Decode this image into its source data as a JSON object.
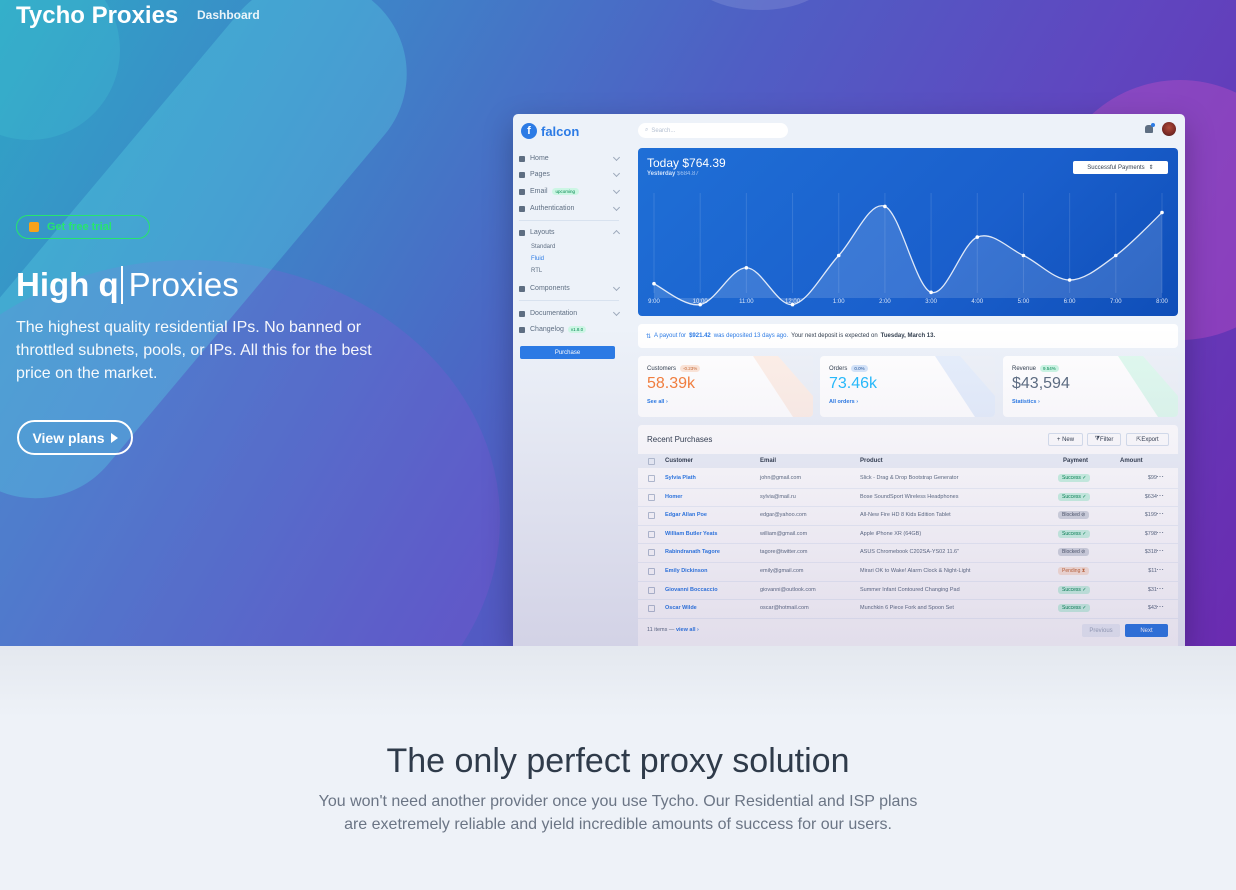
{
  "header": {
    "brand": "Tycho Proxies",
    "nav_link": "Dashboard"
  },
  "hero": {
    "badge": "Get free trial",
    "headline_bold": "High q",
    "headline_rest": "Proxies",
    "subtext": "The highest quality residential IPs. No banned or throttled subnets, pools, or IPs. All this for the best price on the market.",
    "cta": "View plans"
  },
  "dashboard": {
    "logo": "falcon",
    "search_placeholder": "Search...",
    "nav": {
      "home": "Home",
      "pages": "Pages",
      "email": "Email",
      "email_badge": "upcoming",
      "authentication": "Authentication",
      "layouts": "Layouts",
      "standard": "Standard",
      "fluid": "Fluid",
      "rtl": "RTL",
      "components": "Components",
      "documentation": "Documentation",
      "changelog": "Changelog",
      "changelog_badge": "v1.8.0",
      "purchase": "Purchase"
    },
    "payments": {
      "today": "Today $764.39",
      "yesterday_label": "Yesterday",
      "yesterday_value": "$684.87",
      "select": "Successful Payments"
    },
    "notice": {
      "prefix": "A payout for",
      "amount": "$921.42",
      "mid": "was deposited 13 days ago.",
      "rest": "Your next deposit is expected on",
      "date": "Tuesday, March 13."
    },
    "stats": [
      {
        "title": "Customers",
        "badge": "-0.23%",
        "value": "58.39k",
        "link": "See all ›",
        "badge_bg": "#fde6d8",
        "badge_fg": "#c46632",
        "value_color": "#f5803e"
      },
      {
        "title": "Orders",
        "badge": "0.0%",
        "value": "73.46k",
        "link": "All orders ›",
        "badge_bg": "#d5e5fa",
        "badge_fg": "#1c4f93",
        "value_color": "#27bcfd"
      },
      {
        "title": "Revenue",
        "badge": "9.54%",
        "value": "$43,594",
        "link": "Statistics ›",
        "badge_bg": "#ccf6e4",
        "badge_fg": "#00864e",
        "value_color": "#5e6e82"
      }
    ],
    "purchases": {
      "title": "Recent Purchases",
      "btn_new": "+ New",
      "btn_filter": "Filter",
      "btn_export": "Export",
      "columns": [
        "Customer",
        "Email",
        "Product",
        "Payment",
        "Amount"
      ],
      "rows": [
        {
          "customer": "Sylvia Plath",
          "email": "john@gmail.com",
          "product": "Slick - Drag & Drop Bootstrap Generator",
          "status": "Success ✓",
          "status_type": "success",
          "amount": "$99"
        },
        {
          "customer": "Homer",
          "email": "sylvia@mail.ru",
          "product": "Bose SoundSport Wireless Headphones",
          "status": "Success ✓",
          "status_type": "success",
          "amount": "$634"
        },
        {
          "customer": "Edgar Allan Poe",
          "email": "edgar@yahoo.com",
          "product": "All-New Fire HD 8 Kids Edition Tablet",
          "status": "Blocked ⊘",
          "status_type": "blocked",
          "amount": "$199"
        },
        {
          "customer": "William Butler Yeats",
          "email": "william@gmail.com",
          "product": "Apple iPhone XR (64GB)",
          "status": "Success ✓",
          "status_type": "success",
          "amount": "$798"
        },
        {
          "customer": "Rabindranath Tagore",
          "email": "tagore@twitter.com",
          "product": "ASUS Chromebook C202SA-YS02 11.6\"",
          "status": "Blocked ⊘",
          "status_type": "blocked",
          "amount": "$318"
        },
        {
          "customer": "Emily Dickinson",
          "email": "emily@gmail.com",
          "product": "Mirari OK to Wake! Alarm Clock & Night-Light",
          "status": "Pending ⧗",
          "status_type": "pending",
          "amount": "$11"
        },
        {
          "customer": "Giovanni Boccaccio",
          "email": "giovanni@outlook.com",
          "product": "Summer Infant Contoured Changing Pad",
          "status": "Success ✓",
          "status_type": "success",
          "amount": "$31"
        },
        {
          "customer": "Oscar Wilde",
          "email": "oscar@hotmail.com",
          "product": "Munchkin 6 Piece Fork and Spoon Set",
          "status": "Success ✓",
          "status_type": "success",
          "amount": "$43"
        }
      ],
      "footer_count": "11 items —",
      "footer_link": "view all ›",
      "prev": "Previous",
      "next": "Next"
    },
    "chart_data": {
      "type": "line",
      "x": [
        "9:00",
        "10:00",
        "11:00",
        "12:00",
        "1:00",
        "2:00",
        "3:00",
        "4:00",
        "5:00",
        "6:00",
        "7:00",
        "8:00"
      ],
      "values": [
        320,
        150,
        450,
        150,
        550,
        950,
        250,
        700,
        550,
        350,
        550,
        900
      ],
      "ylim": [
        0,
        1100
      ]
    }
  },
  "section": {
    "title": "The only perfect proxy solution",
    "text": "You won't need another provider once you use Tycho. Our Residential and ISP plans are exetremely reliable and yield incredible amounts of success for our users."
  }
}
